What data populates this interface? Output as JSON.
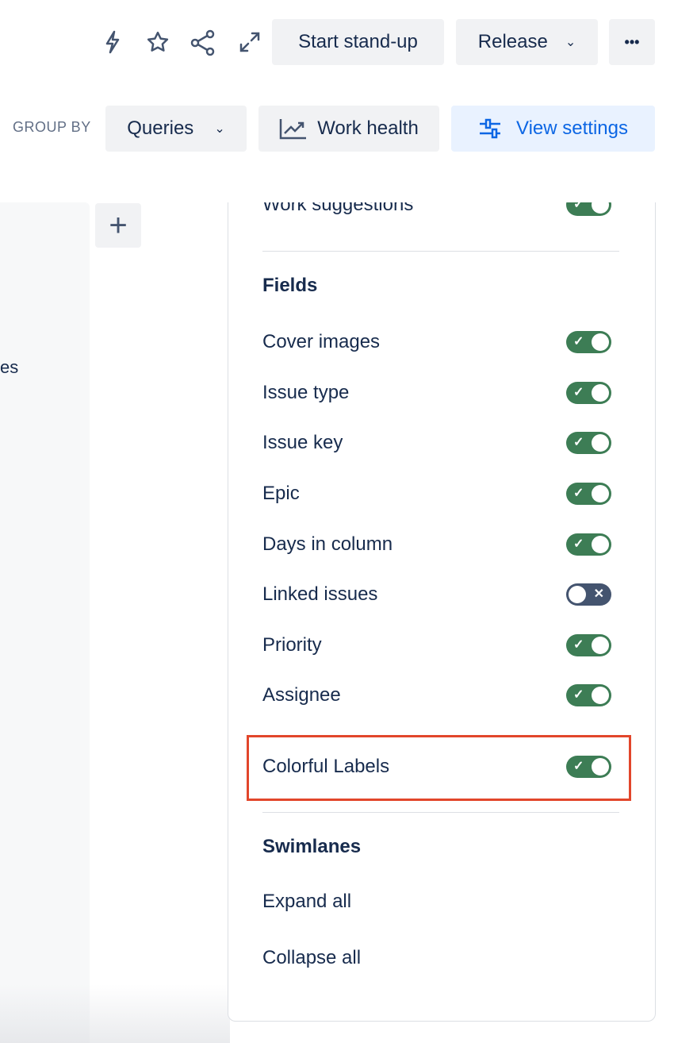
{
  "header": {
    "start_standup": "Start stand-up",
    "release": "Release",
    "more": "•••"
  },
  "toolbar": {
    "group_by": "GROUP BY",
    "queries": "Queries",
    "work_health": "Work health",
    "view_settings": "View settings"
  },
  "board": {
    "partial_text": "es"
  },
  "panel": {
    "work_suggestions": {
      "label": "Work suggestions",
      "on": true
    },
    "fields_heading": "Fields",
    "fields": [
      {
        "label": "Cover images",
        "on": true
      },
      {
        "label": "Issue type",
        "on": true
      },
      {
        "label": "Issue key",
        "on": true
      },
      {
        "label": "Epic",
        "on": true
      },
      {
        "label": "Days in column",
        "on": true
      },
      {
        "label": "Linked issues",
        "on": false
      },
      {
        "label": "Priority",
        "on": true
      },
      {
        "label": "Assignee",
        "on": true
      }
    ],
    "colorful_labels": {
      "label": "Colorful Labels",
      "on": true
    },
    "swimlanes_heading": "Swimlanes",
    "expand_all": "Expand all",
    "collapse_all": "Collapse all"
  },
  "colors": {
    "toggle_on": "#3d7d55",
    "toggle_off": "#44546f",
    "accent": "#0c66e4",
    "highlight_box": "#e2462b"
  }
}
